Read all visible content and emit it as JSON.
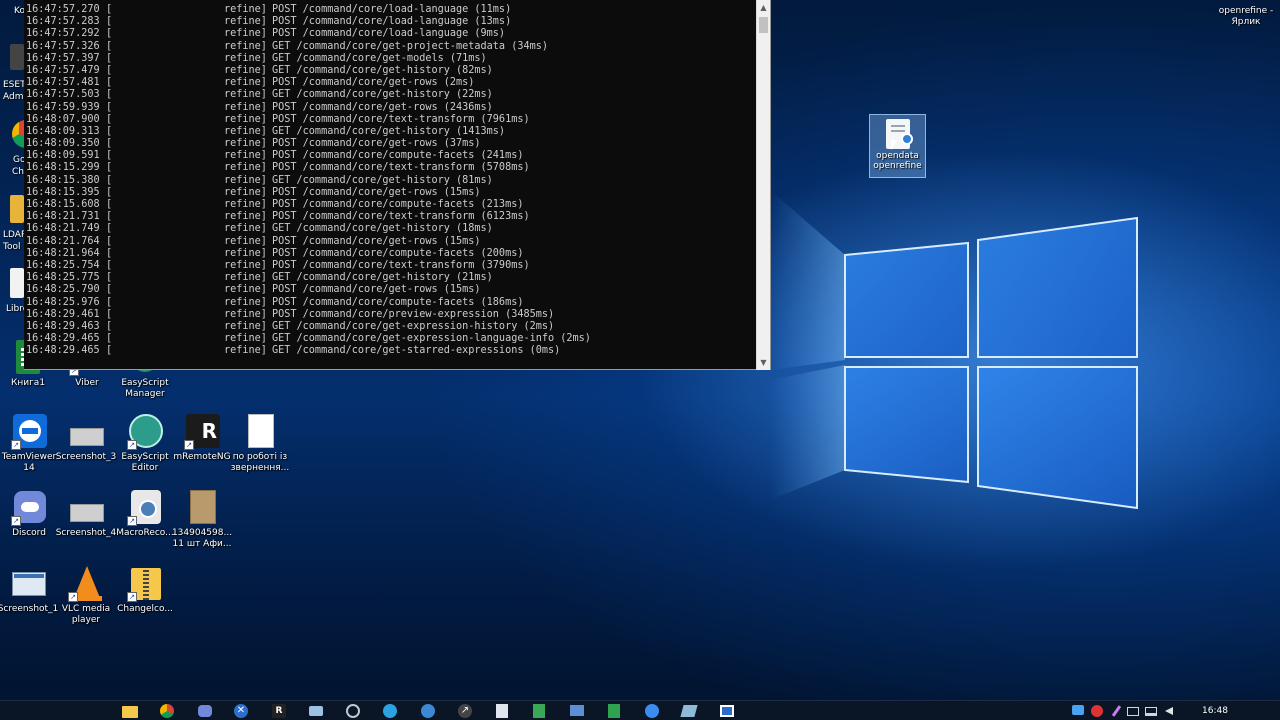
{
  "console": {
    "lines": [
      {
        "ts": "16:47:57.270",
        "src": "refine]",
        "msg": "POST /command/core/load-language (11ms)"
      },
      {
        "ts": "16:47:57.283",
        "src": "refine]",
        "msg": "POST /command/core/load-language (13ms)"
      },
      {
        "ts": "16:47:57.292",
        "src": "refine]",
        "msg": "POST /command/core/load-language (9ms)"
      },
      {
        "ts": "16:47:57.326",
        "src": "refine]",
        "msg": "GET /command/core/get-project-metadata (34ms)"
      },
      {
        "ts": "16:47:57.397",
        "src": "refine]",
        "msg": "GET /command/core/get-models (71ms)"
      },
      {
        "ts": "16:47:57.479",
        "src": "refine]",
        "msg": "GET /command/core/get-history (82ms)"
      },
      {
        "ts": "16:47:57.481",
        "src": "refine]",
        "msg": "POST /command/core/get-rows (2ms)"
      },
      {
        "ts": "16:47:57.503",
        "src": "refine]",
        "msg": "GET /command/core/get-history (22ms)"
      },
      {
        "ts": "16:47:59.939",
        "src": "refine]",
        "msg": "POST /command/core/get-rows (2436ms)"
      },
      {
        "ts": "16:48:07.900",
        "src": "refine]",
        "msg": "POST /command/core/text-transform (7961ms)"
      },
      {
        "ts": "16:48:09.313",
        "src": "refine]",
        "msg": "GET /command/core/get-history (1413ms)"
      },
      {
        "ts": "16:48:09.350",
        "src": "refine]",
        "msg": "POST /command/core/get-rows (37ms)"
      },
      {
        "ts": "16:48:09.591",
        "src": "refine]",
        "msg": "POST /command/core/compute-facets (241ms)"
      },
      {
        "ts": "16:48:15.299",
        "src": "refine]",
        "msg": "POST /command/core/text-transform (5708ms)"
      },
      {
        "ts": "16:48:15.380",
        "src": "refine]",
        "msg": "GET /command/core/get-history (81ms)"
      },
      {
        "ts": "16:48:15.395",
        "src": "refine]",
        "msg": "POST /command/core/get-rows (15ms)"
      },
      {
        "ts": "16:48:15.608",
        "src": "refine]",
        "msg": "POST /command/core/compute-facets (213ms)"
      },
      {
        "ts": "16:48:21.731",
        "src": "refine]",
        "msg": "POST /command/core/text-transform (6123ms)"
      },
      {
        "ts": "16:48:21.749",
        "src": "refine]",
        "msg": "GET /command/core/get-history (18ms)"
      },
      {
        "ts": "16:48:21.764",
        "src": "refine]",
        "msg": "POST /command/core/get-rows (15ms)"
      },
      {
        "ts": "16:48:21.964",
        "src": "refine]",
        "msg": "POST /command/core/compute-facets (200ms)"
      },
      {
        "ts": "16:48:25.754",
        "src": "refine]",
        "msg": "POST /command/core/text-transform (3790ms)"
      },
      {
        "ts": "16:48:25.775",
        "src": "refine]",
        "msg": "GET /command/core/get-history (21ms)"
      },
      {
        "ts": "16:48:25.790",
        "src": "refine]",
        "msg": "POST /command/core/get-rows (15ms)"
      },
      {
        "ts": "16:48:25.976",
        "src": "refine]",
        "msg": "POST /command/core/compute-facets (186ms)"
      },
      {
        "ts": "16:48:29.461",
        "src": "refine]",
        "msg": "POST /command/core/preview-expression (3485ms)"
      },
      {
        "ts": "16:48:29.463",
        "src": "refine]",
        "msg": "GET /command/core/get-expression-history (2ms)"
      },
      {
        "ts": "16:48:29.465",
        "src": "refine]",
        "msg": "GET /command/core/get-expression-language-info (2ms)"
      },
      {
        "ts": "16:48:29.465",
        "src": "refine]",
        "msg": "GET /command/core/get-starred-expressions (0ms)"
      }
    ],
    "bracket": "["
  },
  "desktop": {
    "partial_labels": [
      "Ko",
      "ESET",
      "Admi",
      "Go",
      "Chi",
      "LDAP",
      "Tool",
      "Libre"
    ],
    "top_right_label_1": "openrefine -",
    "top_right_label_2": "Ярлик",
    "selected_icon": {
      "label_1": "opendata",
      "label_2": "openrefine"
    },
    "icons": [
      {
        "id": "kniga1",
        "label_1": "Книга1",
        "label_2": ""
      },
      {
        "id": "viber",
        "label_1": "Viber",
        "label_2": ""
      },
      {
        "id": "easyscript-manager",
        "label_1": "EasyScript",
        "label_2": "Manager"
      },
      {
        "id": "teamviewer",
        "label_1": "TeamViewer",
        "label_2": "14"
      },
      {
        "id": "screenshot3",
        "label_1": "Screenshot_3",
        "label_2": ""
      },
      {
        "id": "easyscript-editor",
        "label_1": "EasyScript",
        "label_2": "Editor"
      },
      {
        "id": "mremoteng",
        "label_1": "mRemoteNG",
        "label_2": ""
      },
      {
        "id": "po-roboti",
        "label_1": "по роботі із",
        "label_2": "звернення..."
      },
      {
        "id": "discord",
        "label_1": "Discord",
        "label_2": ""
      },
      {
        "id": "screenshot4",
        "label_1": "Screenshot_4",
        "label_2": ""
      },
      {
        "id": "macroreco",
        "label_1": "MacroReco...",
        "label_2": ""
      },
      {
        "id": "photo134",
        "label_1": "134904598...",
        "label_2": "11 шт Афи..."
      },
      {
        "id": "screenshot1",
        "label_1": "Screenshot_1",
        "label_2": ""
      },
      {
        "id": "vlc",
        "label_1": "VLC media",
        "label_2": "player"
      },
      {
        "id": "changelog",
        "label_1": "Changelco...",
        "label_2": ""
      }
    ]
  },
  "taskbar": {
    "clock": "16:48"
  },
  "colors": {
    "console_bg": "#0c0c0c",
    "console_text": "#cccccc",
    "taskbar_bg": "#0a1526",
    "windows_blue": "#3c8cf0"
  }
}
